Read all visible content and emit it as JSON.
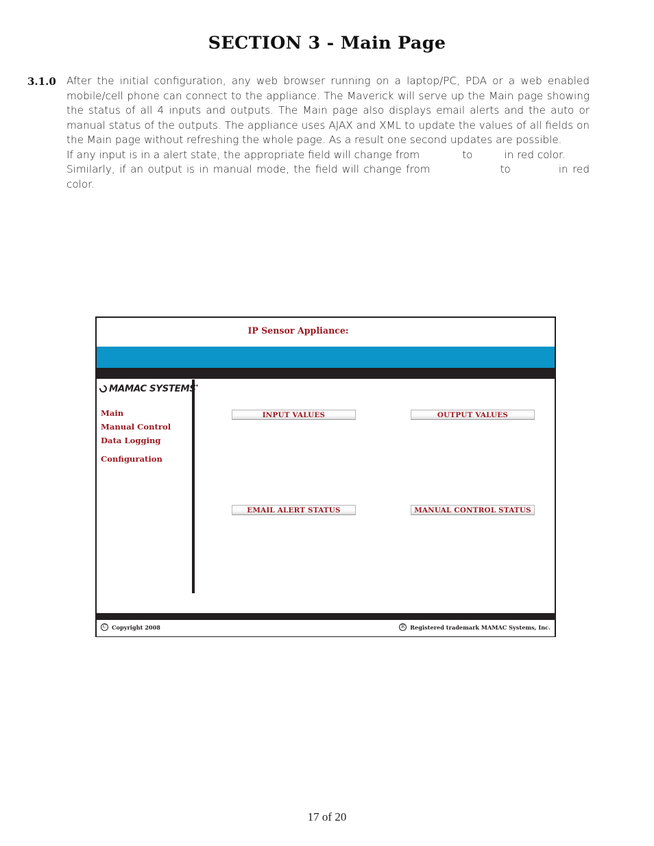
{
  "document": {
    "section_title": "SECTION 3 - Main Page",
    "page_number": "17 of 20"
  },
  "paragraph": {
    "number": "3.1.0",
    "line1": "After the initial configuration, any web browser running on a laptop/PC, PDA or a web enabled mobile/cell phone can connect to the appliance. The Maverick will serve up the Main page showing the status of all 4 inputs and outputs. The Main page also displays email alerts and the auto or manual status of the outputs. The appliance uses AJAX and XML to update the values of all fields on the Main page without refreshing the whole page. As a result one second updates are possible.",
    "line2_a": "If any input is in a alert state, the appropriate field will change from",
    "line2_b": "to",
    "line2_c": "in red color.",
    "line3_a": "Similarly, if an output is in manual mode, the field will change from",
    "line3_b": "to",
    "line3_c": "in red color."
  },
  "mockup": {
    "title": "IP Sensor Appliance:",
    "colors": {
      "accent_cyan": "#0b95c8",
      "dark_bar": "#231f20",
      "heading_red": "#9b1b23"
    },
    "logo": {
      "text": "MAMAC SYSTEMS",
      "trademark": "*"
    },
    "nav": [
      {
        "label": "Main"
      },
      {
        "label": "Manual Control"
      },
      {
        "label": "Data Logging"
      },
      {
        "label": "Configuration"
      }
    ],
    "panels": {
      "input_values": "INPUT VALUES",
      "output_values": "OUTPUT VALUES",
      "email_alert_status": "EMAIL ALERT STATUS",
      "manual_control_status": "MANUAL CONTROL STATUS"
    },
    "footer": {
      "copyright_symbol": "C",
      "copyright_text": "Copyright 2008",
      "registered_symbol": "R",
      "registered_text": "Registered trademark MAMAC Systems, Inc."
    }
  }
}
